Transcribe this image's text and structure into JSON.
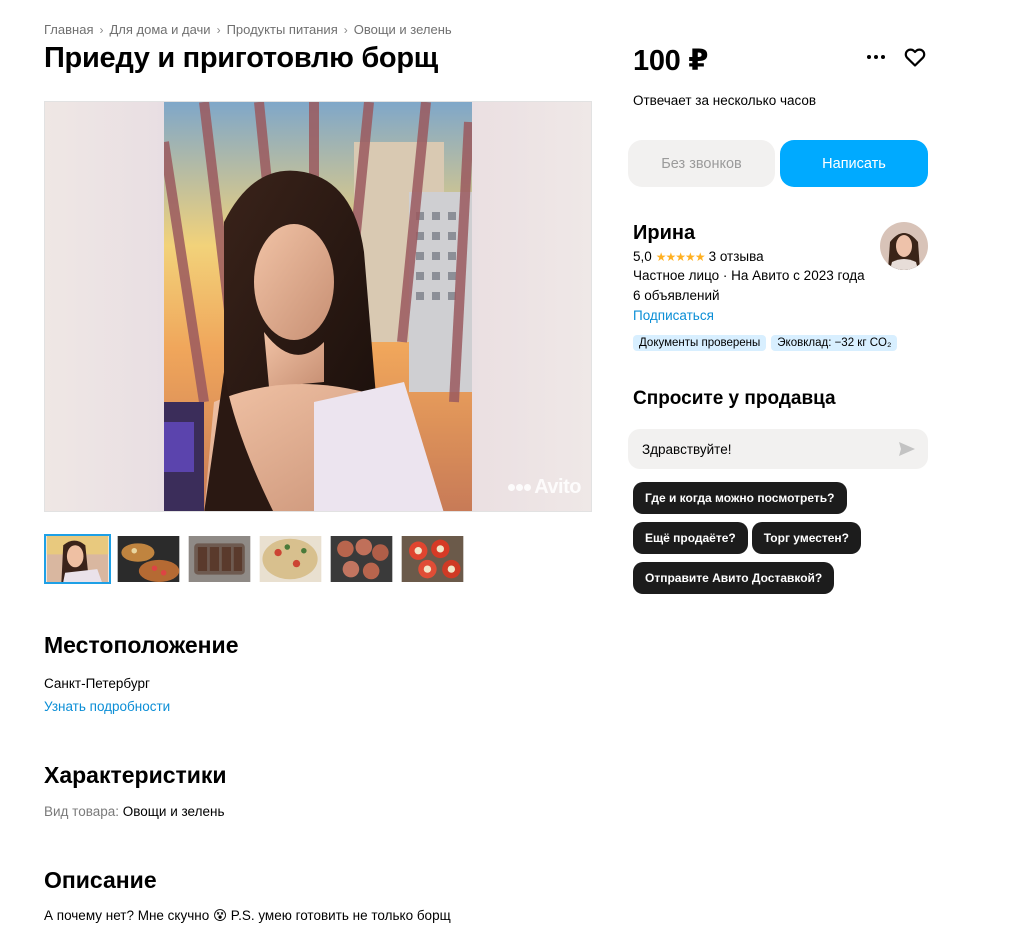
{
  "breadcrumb": [
    "Главная",
    "Для дома и дачи",
    "Продукты питания",
    "Овощи и зелень"
  ],
  "title": "Приеду и приготовлю борщ",
  "gallery": {
    "watermark": "Avito",
    "thumbnails": [
      "photo-1",
      "photo-2",
      "photo-3",
      "photo-4",
      "photo-5",
      "photo-6"
    ],
    "active_index": 0
  },
  "location": {
    "heading": "Местоположение",
    "city": "Санкт-Петербург",
    "details_link": "Узнать подробности"
  },
  "characteristics": {
    "heading": "Характеристики",
    "label": "Вид товара:",
    "value": "Овощи и зелень"
  },
  "description": {
    "heading": "Описание",
    "text": "А почему нет? Мне скучно 😵 P.S. умею готовить не только борщ"
  },
  "price": "100 ₽",
  "response_time": "Отвечает за несколько часов",
  "buttons": {
    "no_calls": "Без звонков",
    "write": "Написать"
  },
  "seller": {
    "name": "Ирина",
    "rating": "5,0",
    "stars": "★★★★★",
    "reviews": "3 отзыва",
    "type": "Частное лицо · На Авито с 2023 года",
    "listings": "6 объявлений",
    "subscribe": "Подписаться",
    "badges": [
      "Документы проверены",
      "Эковклад: −32 кг CO₂"
    ]
  },
  "ask": {
    "heading": "Спросите у продавца",
    "message_value": "Здравствуйте!",
    "quick_questions": [
      "Где и когда можно посмотреть?",
      "Ещё продаёте?",
      "Торг уместен?",
      "Отправите Авито Доставкой?"
    ]
  },
  "colors": {
    "accent": "#00aaff",
    "link": "#0b8ed6",
    "star": "#ffb021",
    "chip": "#1c1c1c",
    "badge": "#d8efff"
  }
}
